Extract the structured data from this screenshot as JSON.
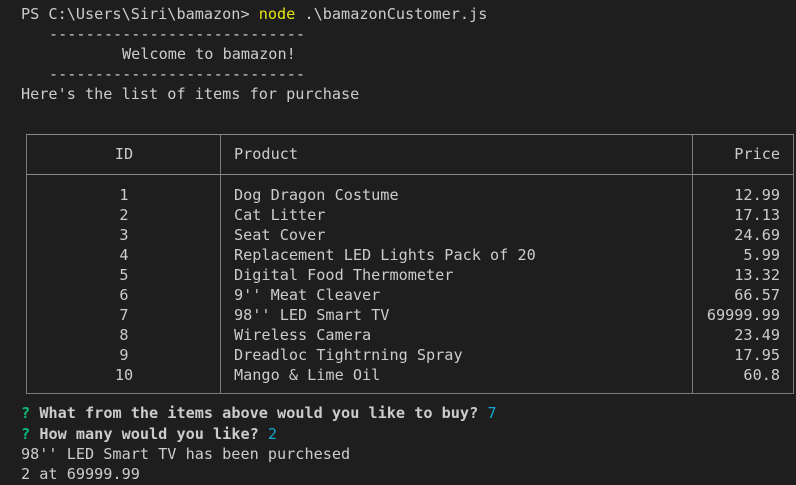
{
  "prompt": {
    "ps": "PS C:\\Users\\Siri\\bamazon> ",
    "command": "node",
    "args": " .\\bamazonCustomer.js"
  },
  "banner": {
    "rule": "----------------------------",
    "welcome": "Welcome to bamazon!"
  },
  "intro": "Here's the list of items for purchase",
  "table": {
    "headers": {
      "id": "ID",
      "product": "Product",
      "price": "Price"
    },
    "rows": [
      {
        "id": "1",
        "product": "Dog Dragon Costume",
        "price": "12.99"
      },
      {
        "id": "2",
        "product": "Cat Litter",
        "price": "17.13"
      },
      {
        "id": "3",
        "product": "Seat Cover",
        "price": "24.69"
      },
      {
        "id": "4",
        "product": "Replacement LED Lights Pack of 20",
        "price": "5.99"
      },
      {
        "id": "5",
        "product": "Digital Food Thermometer",
        "price": "13.32"
      },
      {
        "id": "6",
        "product": "9'' Meat Cleaver",
        "price": "66.57"
      },
      {
        "id": "7",
        "product": "98'' LED Smart TV",
        "price": "69999.99"
      },
      {
        "id": "8",
        "product": "Wireless Camera",
        "price": "23.49"
      },
      {
        "id": "9",
        "product": "Dreadloc Tightrning Spray",
        "price": "17.95"
      },
      {
        "id": "10",
        "product": "Mango & Lime Oil",
        "price": "60.8"
      }
    ]
  },
  "questions": [
    {
      "mark": "?",
      "text": "What from the items above would you like to buy?",
      "answer": "7"
    },
    {
      "mark": "?",
      "text": "How many would you like?",
      "answer": "2"
    }
  ],
  "output": [
    "98'' LED Smart TV has been purchesed",
    "2 at 69999.99"
  ],
  "colors": {
    "background": "#1e1e1e",
    "text": "#cccccc",
    "command": "#e5e510",
    "question_mark": "#0dbc79",
    "answer": "#11a8cd"
  }
}
